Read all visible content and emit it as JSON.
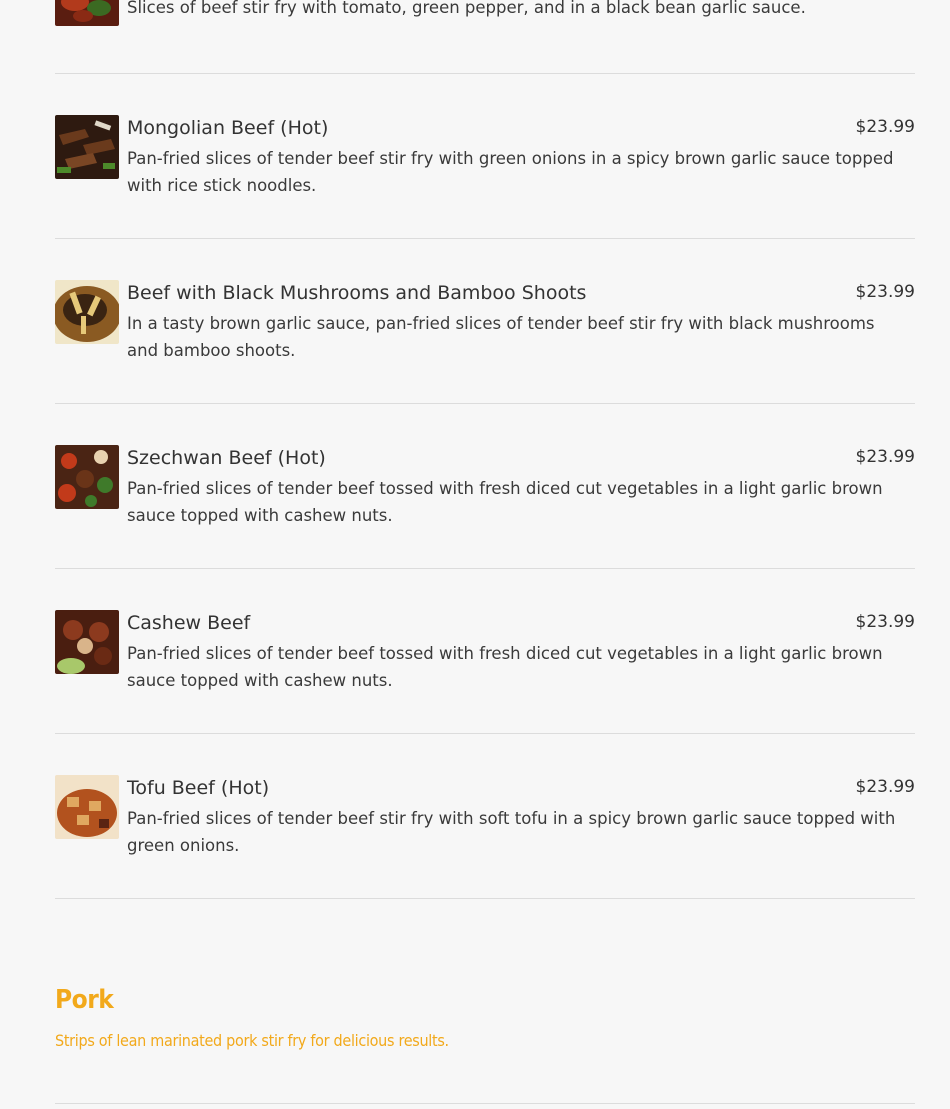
{
  "menu": {
    "items": [
      {
        "name": "",
        "price": "",
        "description": "Slices of beef stir fry with tomato, green pepper, and in a black bean garlic sauce.",
        "image": "tomato-beef-photo-icon",
        "colors": [
          "#5a1d10",
          "#b23a1c",
          "#3b6a22",
          "#d8c7a0"
        ]
      },
      {
        "name": "Mongolian Beef (Hot)",
        "price": "$23.99",
        "description": "Pan-fried slices of tender beef stir fry with green onions in a spicy brown garlic sauce topped with rice stick noodles.",
        "image": "mongolian-beef-photo-icon",
        "colors": [
          "#2e1a10",
          "#6a3a1c",
          "#4d8a2a",
          "#e0d8c8"
        ]
      },
      {
        "name": "Beef with Black Mushrooms and Bamboo Shoots",
        "price": "$23.99",
        "description": "In a tasty brown garlic sauce, pan-fried slices of tender beef stir fry with black mushrooms and bamboo shoots.",
        "image": "beef-mushroom-bamboo-photo-icon",
        "colors": [
          "#3a2412",
          "#8a5a22",
          "#e6c97a",
          "#f0e6c8"
        ]
      },
      {
        "name": "Szechwan Beef (Hot)",
        "price": "$23.99",
        "description": "Pan-fried slices of tender beef tossed with fresh diced cut vegetables in a light garlic brown sauce topped with cashew nuts.",
        "image": "szechwan-beef-photo-icon",
        "colors": [
          "#4a2414",
          "#c23a1a",
          "#3f7a2a",
          "#e8d2b0"
        ]
      },
      {
        "name": "Cashew Beef",
        "price": "$23.99",
        "description": "Pan-fried slices of tender beef tossed with fresh diced cut vegetables in a light garlic brown sauce topped with cashew nuts.",
        "image": "cashew-beef-photo-icon",
        "colors": [
          "#4a1e10",
          "#8c3a1e",
          "#a8c86a",
          "#d9b48a"
        ]
      },
      {
        "name": "Tofu Beef (Hot)",
        "price": "$23.99",
        "description": "Pan-fried slices of tender beef stir fry with soft tofu in a spicy brown garlic sauce topped with green onions.",
        "image": "tofu-beef-photo-icon",
        "colors": [
          "#5a2412",
          "#b2521e",
          "#e0a860",
          "#f2e2c8"
        ]
      }
    ]
  },
  "section": {
    "title": "Pork",
    "subtitle": "Strips of lean marinated pork stir fry for delicious results."
  },
  "colors": {
    "accent": "#f2a91b",
    "background": "#f7f7f7",
    "text": "#333333",
    "divider": "#dcdcdc"
  }
}
